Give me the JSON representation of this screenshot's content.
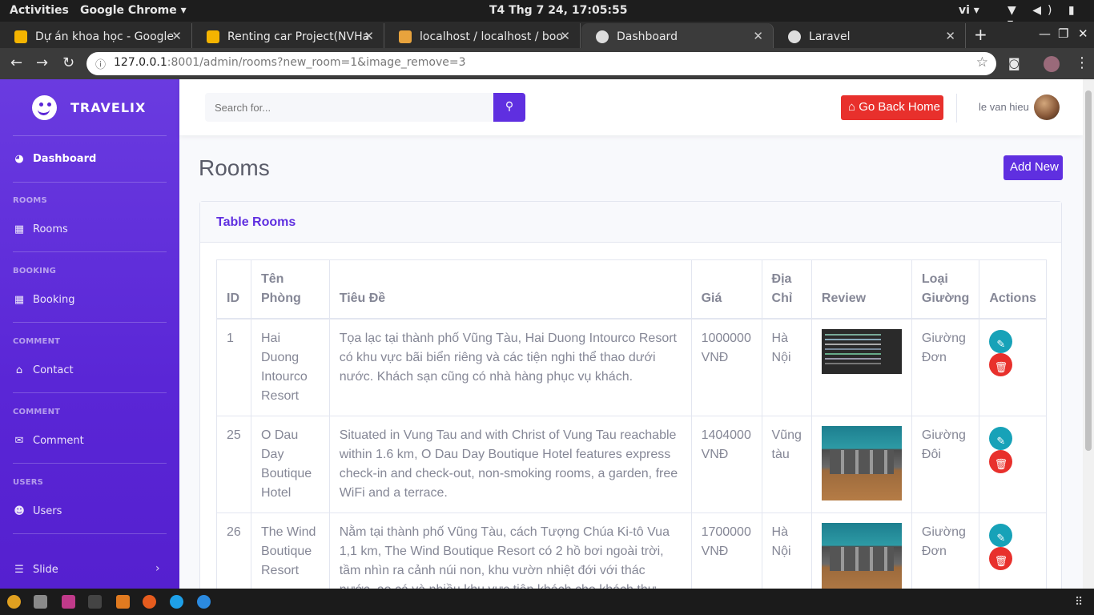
{
  "system": {
    "activities": "Activities",
    "app_menu": "Google Chrome ▾",
    "clock": "T4 Thg 7 24, 17:05:55",
    "lang": "vi ▾",
    "tray": "▼ ◀) ▮ ▾"
  },
  "tabs": [
    {
      "title": "Dự án khoa học - Google",
      "icon_color": "#f4b400"
    },
    {
      "title": "Renting car Project(NVHa",
      "icon_color": "#f4b400"
    },
    {
      "title": "localhost / localhost / boo",
      "icon_color": "#e8a33d"
    },
    {
      "title": "Dashboard",
      "icon_color": "#dddddd"
    },
    {
      "title": "Laravel",
      "icon_color": "#dddddd"
    }
  ],
  "browser": {
    "url_host": "127.0.0.1",
    "url_rest": ":8001/admin/rooms?new_room=1&image_remove=3"
  },
  "sidebar": {
    "brand": "TRAVELIX",
    "dashboard": "Dashboard",
    "sections": [
      {
        "heading": "ROOMS",
        "item": "Rooms"
      },
      {
        "heading": "BOOKING",
        "item": "Booking"
      },
      {
        "heading": "COMMENT",
        "item": "Contact"
      },
      {
        "heading": "COMMENT",
        "item": "Comment"
      },
      {
        "heading": "USERS",
        "item": "Users"
      }
    ],
    "slide": "Slide"
  },
  "header": {
    "search_placeholder": "Search for...",
    "home_button": "Go Back Home",
    "user_name": "le van hieu"
  },
  "main": {
    "title": "Rooms",
    "add_button": "Add New",
    "card_title": "Table Rooms",
    "columns": [
      "ID",
      "Tên Phòng",
      "Tiêu Đề",
      "Giá",
      "Địa Chỉ",
      "Review",
      "Loại Giường",
      "Actions"
    ],
    "rows": [
      {
        "id": "1",
        "name": "Hai Duong Intourco Resort",
        "desc": "Tọa lạc tại thành phố Vũng Tàu, Hai Duong Intourco Resort có khu vực bãi biển riêng và các tiện nghi thể thao dưới nước. Khách sạn cũng có nhà hàng phục vụ khách.",
        "price": "1000000 VNĐ",
        "address": "Hà Nội",
        "bed": "Giường Đơn"
      },
      {
        "id": "25",
        "name": "O Dau Day Boutique Hotel",
        "desc": "Situated in Vung Tau and with Christ of Vung Tau reachable within 1.6 km, O Dau Day Boutique Hotel features express check-in and check-out, non-smoking rooms, a garden, free WiFi and a terrace.",
        "price": "1404000 VNĐ",
        "address": "Vũng tàu",
        "bed": "Giường Đôi"
      },
      {
        "id": "26",
        "name": "The Wind Boutique Resort",
        "desc": "Nằm tại thành phố Vũng Tàu, cách Tượng Chúa Ki-tô Vua 1,1 km, The Wind Boutique Resort có 2 hồ bơi ngoài trời, tầm nhìn ra cảnh núi non, khu vườn nhiệt đới với thác nước, ao cá và nhiều khu vực tiện khách cho khách thư giãn với lò đề nướng",
        "price": "1700000 VNĐ",
        "address": "Hà Nội",
        "bed": "Giường Đơn"
      }
    ]
  }
}
